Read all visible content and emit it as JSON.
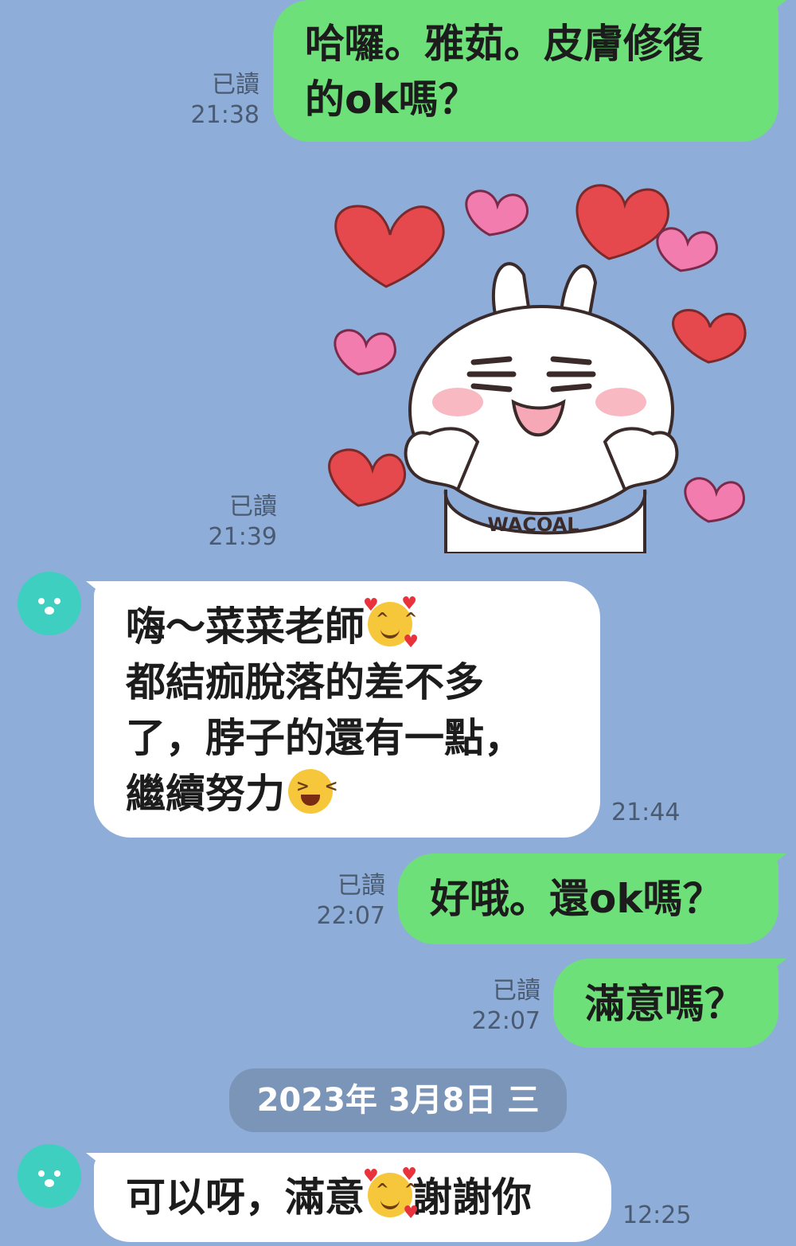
{
  "messages": [
    {
      "lines": [
        "哈囉。雅茹。皮膚修復",
        "的ok嗎？"
      ],
      "read": "已讀",
      "time": "21:38"
    },
    {
      "read": "已讀",
      "time": "21:39",
      "sticker_text": "WACOAL"
    },
    {
      "lines": [
        "嗨～菜菜老師",
        "都結痂脫落的差不多",
        "了，脖子的還有一點，",
        "繼續努力"
      ],
      "time": "21:44"
    },
    {
      "lines": [
        "好哦。還ok嗎？"
      ],
      "read": "已讀",
      "time": "22:07"
    },
    {
      "lines": [
        "滿意嗎？"
      ],
      "read": "已讀",
      "time": "22:07"
    },
    {
      "lines": [
        "可以呀，滿意",
        "謝謝你"
      ],
      "time": "12:25"
    }
  ],
  "date_separator": "2023年 3月8日 三",
  "icons": {
    "avatar": "bear-avatar-icon",
    "emoji_love": "smiling-face-with-hearts-emoji",
    "emoji_grin": "grinning-squinting-face-emoji"
  },
  "colors": {
    "background": "#8eaed9",
    "outgoing_bubble": "#6ee07a",
    "incoming_bubble": "#ffffff",
    "date_pill": "#7b95b8",
    "avatar": "#3fcfc0"
  }
}
